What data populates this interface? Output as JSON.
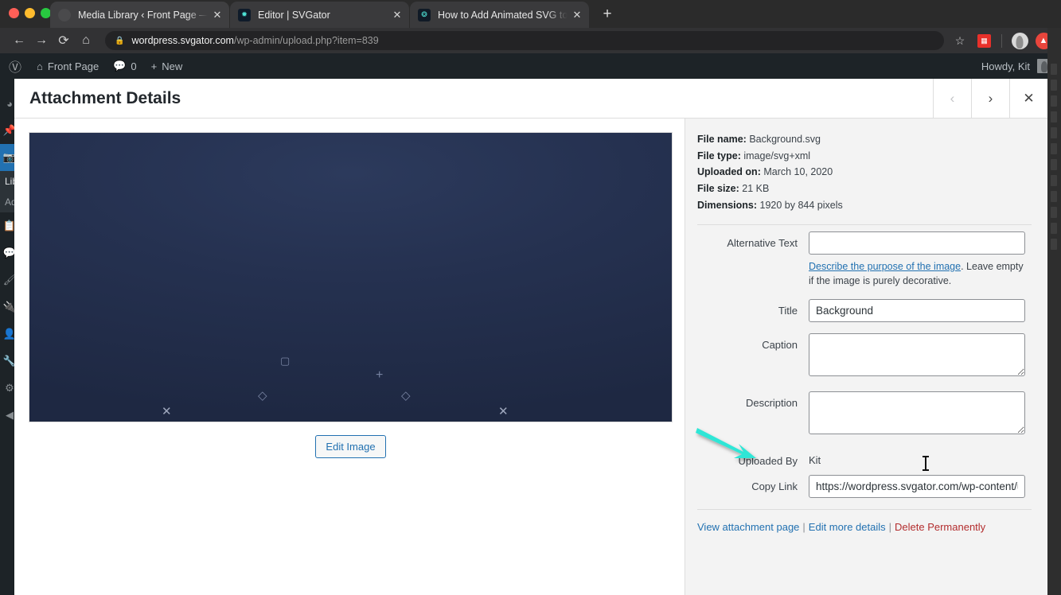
{
  "browser": {
    "tabs": [
      {
        "title": "Media Library ‹ Front Page — WordPress",
        "favicon": "generic-circle-icon",
        "active": true
      },
      {
        "title": "Editor | SVGator",
        "favicon": "svgator-icon",
        "active": false
      },
      {
        "title": "How to Add Animated SVG to WordPress",
        "favicon": "blog-icon",
        "active": false
      }
    ],
    "new_tab_label": "+",
    "back_icon": "←",
    "forward_icon": "→",
    "reload_icon": "⟳",
    "home_icon": "⌂",
    "lock_icon": "🔒",
    "url_domain": "wordpress.svgator.com",
    "url_path": "/wp-admin/upload.php?item=839",
    "bookmark_icon": "☆",
    "extension_icon": "grid-extension-icon",
    "avatar_icon": "profile-avatar-icon",
    "profile_icon": "account-badge-icon",
    "close_glyph": "✕"
  },
  "adminbar": {
    "logo": "wordpress-logo-icon",
    "home_icon": "⌂",
    "site_name": "Front Page",
    "comments_icon": "comment-bubble-icon",
    "comments_count": "0",
    "new_icon": "+",
    "new_label": "New",
    "howdy": "Howdy, Kit"
  },
  "sidebar": {
    "items": [
      {
        "name": "dashboard",
        "icon": "dashboard-gauge-icon"
      },
      {
        "name": "posts",
        "icon": "pin-icon"
      },
      {
        "name": "media",
        "icon": "media-camera-icon",
        "current": true
      },
      {
        "name": "pages",
        "icon": "pages-icon"
      },
      {
        "name": "comments",
        "icon": "comment-bubble-icon"
      },
      {
        "name": "appearance",
        "icon": "paintbrush-icon"
      },
      {
        "name": "plugins",
        "icon": "plug-icon"
      },
      {
        "name": "users",
        "icon": "user-icon"
      },
      {
        "name": "tools",
        "icon": "wrench-icon"
      },
      {
        "name": "settings",
        "icon": "settings-sliders-icon"
      },
      {
        "name": "collapse-menu",
        "icon": "collapse-arrow-icon"
      }
    ],
    "submenu": [
      {
        "label": "Library",
        "truncated": "Lib",
        "active": true
      },
      {
        "label": "Add New",
        "truncated": "Ad",
        "active": false
      }
    ]
  },
  "modal": {
    "title": "Attachment Details",
    "prev_icon": "‹",
    "next_icon": "›",
    "close_icon": "✕"
  },
  "preview": {
    "background_color": "#212c47",
    "shapes": [
      {
        "glyph": "▢",
        "name": "square-shape"
      },
      {
        "glyph": "+",
        "name": "plus-shape"
      },
      {
        "glyph": "◇",
        "name": "diamond-shape-left"
      },
      {
        "glyph": "◇",
        "name": "diamond-shape-right"
      },
      {
        "glyph": "✕",
        "name": "cross-shape-left"
      },
      {
        "glyph": "✕",
        "name": "cross-shape-right"
      }
    ],
    "edit_image_label": "Edit Image"
  },
  "details": {
    "file_name_label": "File name:",
    "file_name": "Background.svg",
    "file_type_label": "File type:",
    "file_type": "image/svg+xml",
    "uploaded_on_label": "Uploaded on:",
    "uploaded_on": "March 10, 2020",
    "file_size_label": "File size:",
    "file_size": "21 KB",
    "dimensions_label": "Dimensions:",
    "dimensions": "1920 by 844 pixels"
  },
  "form": {
    "alt_text_label": "Alternative Text",
    "alt_text_value": "",
    "alt_hint_link": "Describe the purpose of the image",
    "alt_hint_rest": ". Leave empty if the image is purely decorative.",
    "title_label": "Title",
    "title_value": "Background",
    "caption_label": "Caption",
    "caption_value": "",
    "description_label": "Description",
    "description_value": "",
    "uploaded_by_label": "Uploaded By",
    "uploaded_by_value": "Kit",
    "copy_link_label": "Copy Link",
    "copy_link_value": "https://wordpress.svgator.com/wp-content/u"
  },
  "footer_links": {
    "view_attachment": "View attachment page",
    "edit_more": "Edit more details",
    "delete": "Delete Permanently",
    "separator": "|"
  },
  "annotation": {
    "arrow_color": "#2EE6D6",
    "arrow_name": "copy-link-pointer-arrow"
  }
}
